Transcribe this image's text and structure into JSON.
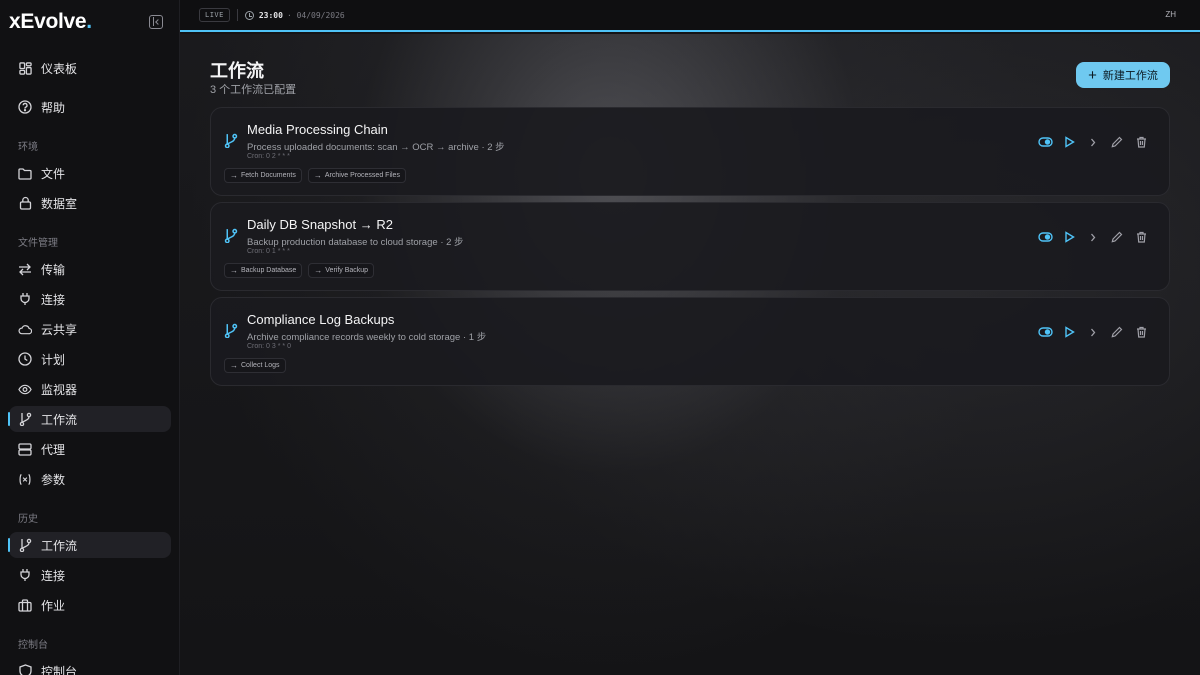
{
  "app": {
    "logo": "xEvolve",
    "logo_dot": "."
  },
  "topbar": {
    "live": "LIVE",
    "time": "23:00",
    "date": "· 04/09/2026",
    "lang": "ZH"
  },
  "sidebar": {
    "top_items": [
      {
        "label": "仪表板",
        "icon": "dashboard-icon"
      },
      {
        "label": "帮助",
        "icon": "help-icon"
      }
    ],
    "sections": [
      {
        "label": "环境",
        "items": [
          {
            "label": "文件",
            "icon": "folder-icon"
          },
          {
            "label": "数据室",
            "icon": "lock-icon"
          }
        ]
      },
      {
        "label": "文件管理",
        "items": [
          {
            "label": "传输",
            "icon": "transfer-icon"
          },
          {
            "label": "连接",
            "icon": "plug-icon"
          },
          {
            "label": "云共享",
            "icon": "cloud-icon"
          },
          {
            "label": "计划",
            "icon": "clock-icon"
          },
          {
            "label": "监视器",
            "icon": "eye-icon"
          },
          {
            "label": "工作流",
            "icon": "workflow-icon",
            "active": true
          },
          {
            "label": "代理",
            "icon": "server-icon"
          },
          {
            "label": "参数",
            "icon": "variable-icon"
          }
        ]
      },
      {
        "label": "历史",
        "items": [
          {
            "label": "工作流",
            "icon": "workflow-icon",
            "active": true
          },
          {
            "label": "连接",
            "icon": "plug-icon"
          },
          {
            "label": "作业",
            "icon": "briefcase-icon"
          }
        ]
      },
      {
        "label": "控制台",
        "items": [
          {
            "label": "控制台",
            "icon": "shield-icon"
          }
        ]
      }
    ]
  },
  "main": {
    "title": "工作流",
    "subtitle": "3 个工作流已配置",
    "new_button": "新建工作流",
    "workflows": [
      {
        "name": "Media Processing Chain",
        "description": "Process uploaded documents: scan → OCR → archive",
        "steps": "· 2 步",
        "cron": "Cron: 0 2 * * *",
        "chips": [
          "Fetch Documents",
          "Archive Processed Files"
        ]
      },
      {
        "name": "Daily DB Snapshot → R2",
        "description": "Backup production database to cloud storage",
        "steps": "· 2 步",
        "cron": "Cron: 0 1 * * *",
        "chips": [
          "Backup Database",
          "Verify Backup"
        ]
      },
      {
        "name": "Compliance Log Backups",
        "description": "Archive compliance records weekly to cold storage",
        "steps": "· 1 步",
        "cron": "Cron: 0 3 * * 0",
        "chips": [
          "Collect Logs"
        ]
      }
    ]
  },
  "colors": {
    "accent": "#4fc3f7",
    "button_bg": "#6fc9f0"
  }
}
